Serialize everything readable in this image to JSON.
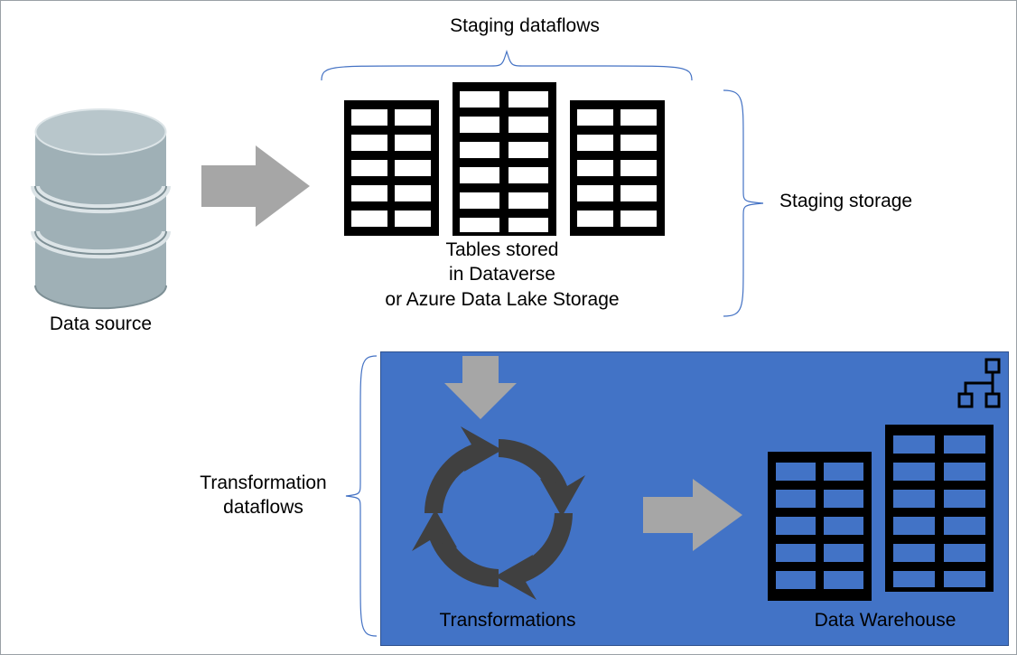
{
  "labels": {
    "staging_dataflows": "Staging dataflows",
    "staging_storage": "Staging storage",
    "transformation_dataflows": "Transformation\ndataflows",
    "data_source": "Data source",
    "tables_stored": "Tables stored\nin Dataverse\nor Azure Data Lake Storage",
    "transformations": "Transformations",
    "data_warehouse": "Data Warehouse"
  },
  "colors": {
    "box_fill": "#4273c6",
    "box_border": "#2f528f",
    "arrow_gray": "#a6a6a6",
    "brace_blue": "#4472c4",
    "dark_arrows": "#404040",
    "cylinder_light": "#9fb0b6",
    "cylinder_dark": "#7d8f95"
  }
}
